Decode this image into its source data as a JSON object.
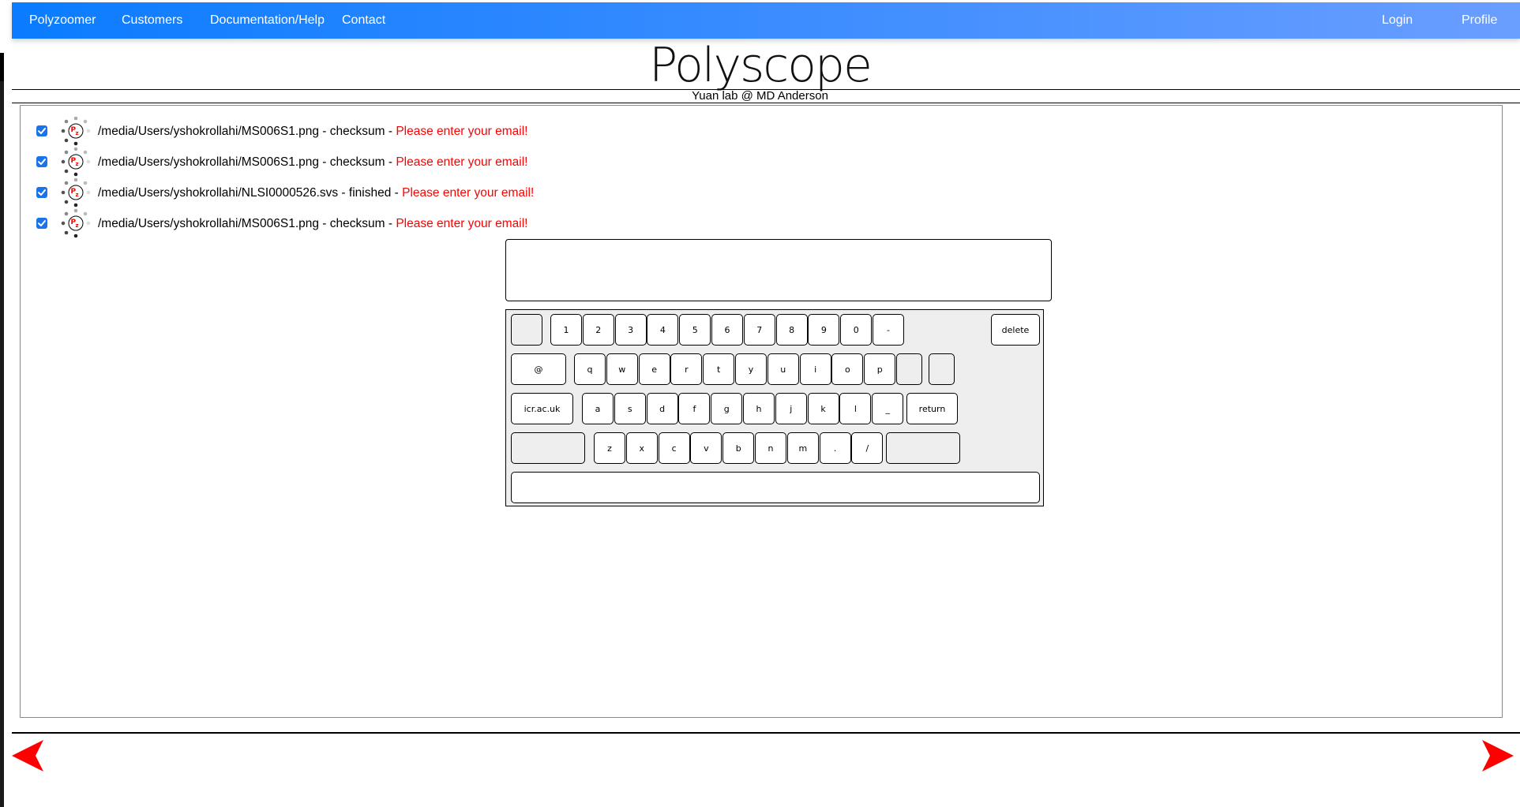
{
  "nav": {
    "left": [
      {
        "label": "Polyzoomer"
      },
      {
        "label": "Customers"
      },
      {
        "label": "Documentation/Help"
      },
      {
        "label": "Contact"
      }
    ],
    "right": [
      {
        "label": "Login"
      },
      {
        "label": "Profile"
      }
    ],
    "gradient": [
      "#0a7cff",
      "#6a9eff"
    ]
  },
  "header": {
    "title": "Polyscope",
    "subtitle": "Yuan lab @ MD Anderson"
  },
  "jobs": [
    {
      "checked": true,
      "path": "/media/Users/yshokrollahi/MS006S1.png",
      "status": "checksum",
      "message": "Please enter your email!",
      "icon": "pz-spinner-icon"
    },
    {
      "checked": true,
      "path": "/media/Users/yshokrollahi/MS006S1.png",
      "status": "checksum",
      "message": "Please enter your email!",
      "icon": "pz-spinner-icon"
    },
    {
      "checked": true,
      "path": "/media/Users/yshokrollahi/NLSI0000526.svs",
      "status": "finished",
      "message": "Please enter your email!",
      "icon": "pz-spinner-icon"
    },
    {
      "checked": true,
      "path": "/media/Users/yshokrollahi/MS006S1.png",
      "status": "checksum",
      "message": "Please enter your email!",
      "icon": "pz-spinner-icon"
    }
  ],
  "separator": " - ",
  "keyboard": {
    "input_value": "",
    "rows": [
      [
        "",
        "1",
        "2",
        "3",
        "4",
        "5",
        "6",
        "7",
        "8",
        "9",
        "0",
        "-",
        "delete"
      ],
      [
        "@",
        "q",
        "w",
        "e",
        "r",
        "t",
        "y",
        "u",
        "i",
        "o",
        "p",
        "",
        ""
      ],
      [
        "icr.ac.uk",
        "a",
        "s",
        "d",
        "f",
        "g",
        "h",
        "j",
        "k",
        "l",
        "_",
        "return"
      ],
      [
        "",
        "z",
        "x",
        "c",
        "v",
        "b",
        "n",
        "m",
        ".",
        "/",
        ""
      ],
      [
        ""
      ]
    ]
  },
  "pager": {
    "prev_icon": "arrow-left-icon",
    "next_icon": "arrow-right-icon",
    "color": "#ff0000"
  },
  "colors": {
    "error": "#ff0000",
    "checkbox": "#1a73e8"
  }
}
